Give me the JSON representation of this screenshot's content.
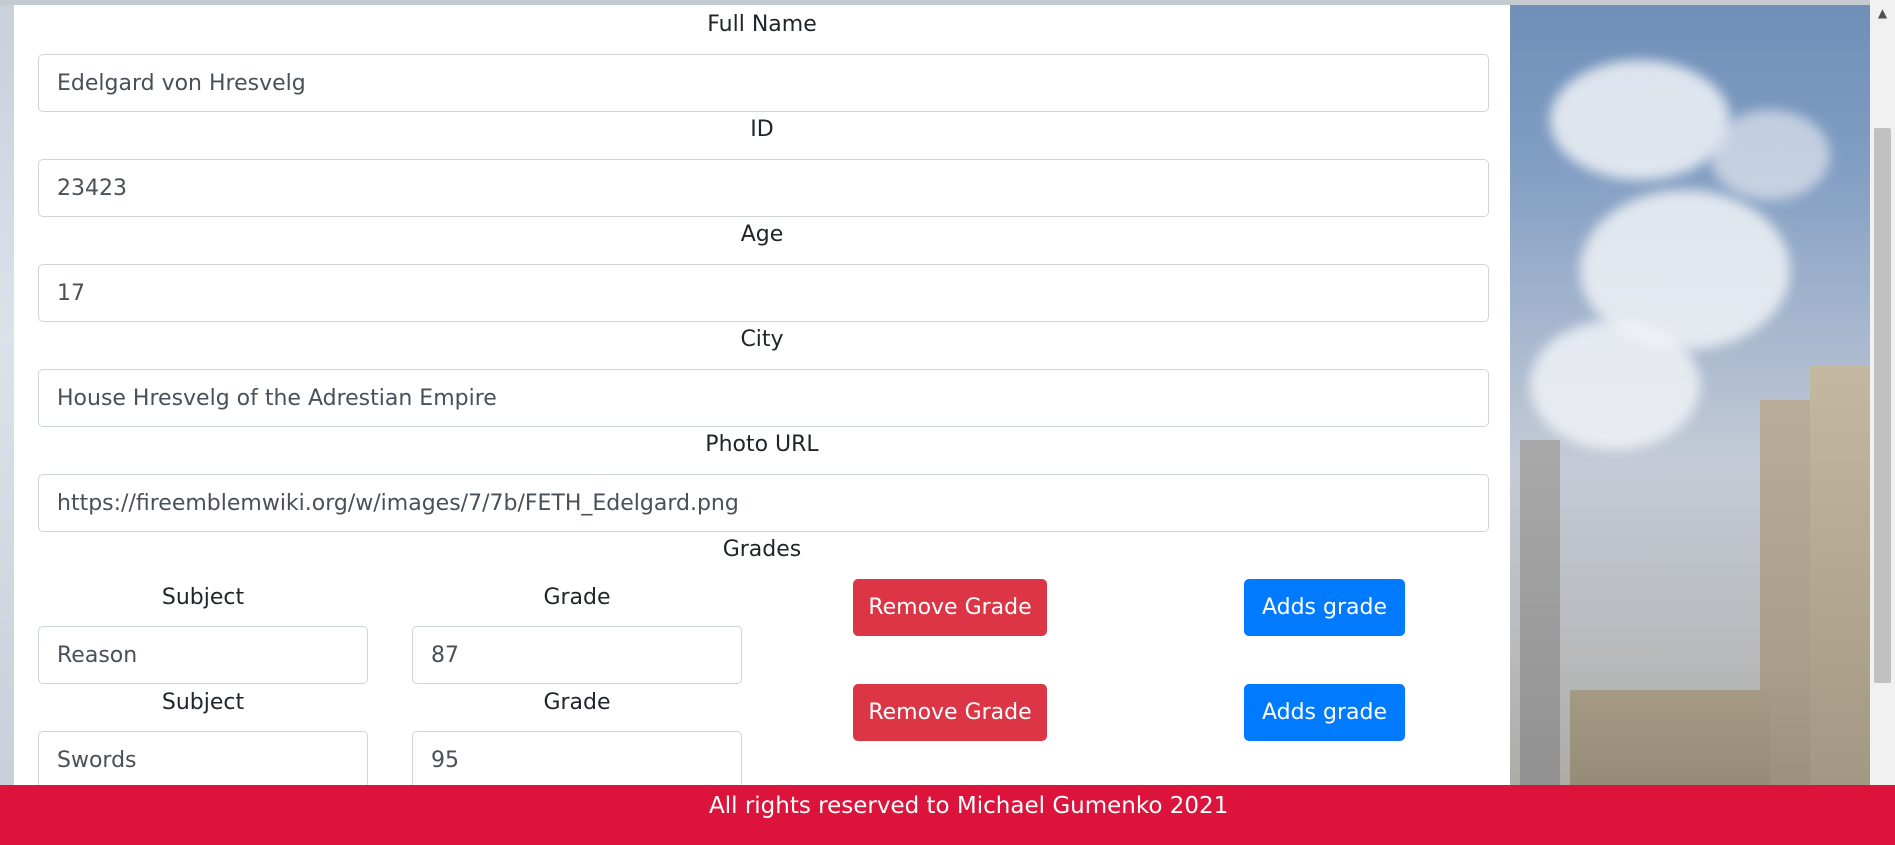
{
  "form": {
    "fields": [
      {
        "label": "Full Name",
        "value": "Edelgard von Hresvelg"
      },
      {
        "label": "ID",
        "value": "23423"
      },
      {
        "label": "Age",
        "value": "17"
      },
      {
        "label": "City",
        "value": "House Hresvelg of the Adrestian Empire"
      },
      {
        "label": "Photo URL",
        "value": "https://fireemblemwiki.org/w/images/7/7b/FETH_Edelgard.png"
      }
    ],
    "grades_heading": "Grades",
    "grades": [
      {
        "subject_label": "Subject",
        "subject": "Reason",
        "grade_label": "Grade",
        "grade": "87",
        "remove_label": "Remove Grade",
        "add_label": "Adds grade"
      },
      {
        "subject_label": "Subject",
        "subject": "Swords",
        "grade_label": "Grade",
        "grade": "95",
        "remove_label": "Remove Grade",
        "add_label": "Adds grade"
      }
    ]
  },
  "footer": {
    "text": "All rights reserved to Michael Gumenko 2021"
  },
  "colors": {
    "danger": "#dc3545",
    "primary": "#007bff",
    "footer": "#dc143c"
  }
}
